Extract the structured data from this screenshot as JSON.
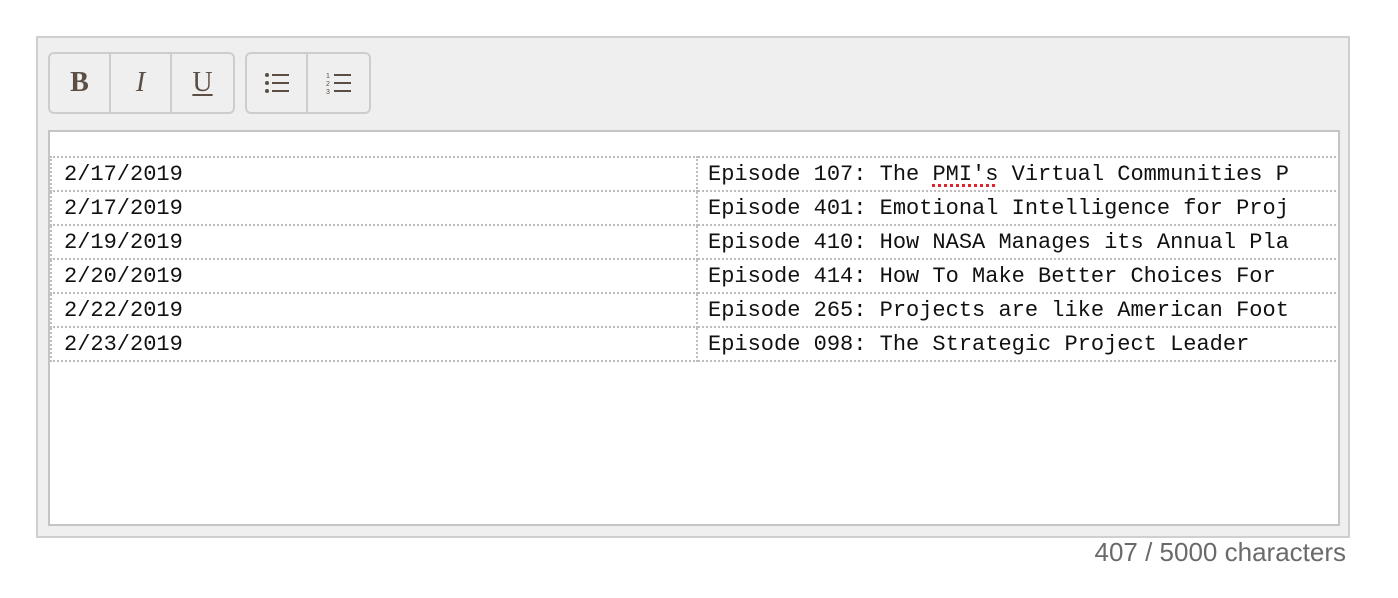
{
  "toolbar": {
    "bold_label": "B",
    "italic_label": "I",
    "underline_label": "U",
    "icons": [
      "bulleted-list-icon",
      "numbered-list-icon"
    ]
  },
  "table": {
    "rows": [
      {
        "date": "2/17/2019",
        "title_pre": "Episode 107: The ",
        "title_flag": "PMI's",
        "title_post": " Virtual Communities P"
      },
      {
        "date": "2/17/2019",
        "title_pre": "Episode 401: Emotional Intelligence for Proj",
        "title_flag": "",
        "title_post": ""
      },
      {
        "date": "2/19/2019",
        "title_pre": "Episode 410: How NASA Manages its Annual Pla",
        "title_flag": "",
        "title_post": ""
      },
      {
        "date": "2/20/2019",
        "title_pre": "Episode 414: How To Make Better Choices For ",
        "title_flag": "",
        "title_post": ""
      },
      {
        "date": "2/22/2019",
        "title_pre": "Episode 265: Projects are like American Foot",
        "title_flag": "",
        "title_post": ""
      },
      {
        "date": "2/23/2019",
        "title_pre": "Episode 098: The Strategic Project Leader",
        "title_flag": "",
        "title_post": ""
      }
    ]
  },
  "char_count": "407 / 5000 characters",
  "colors": {
    "frame_bg": "#efefef",
    "spellcheck_underline": "#e0242b",
    "toolbar_icon": "#5b4f45"
  }
}
